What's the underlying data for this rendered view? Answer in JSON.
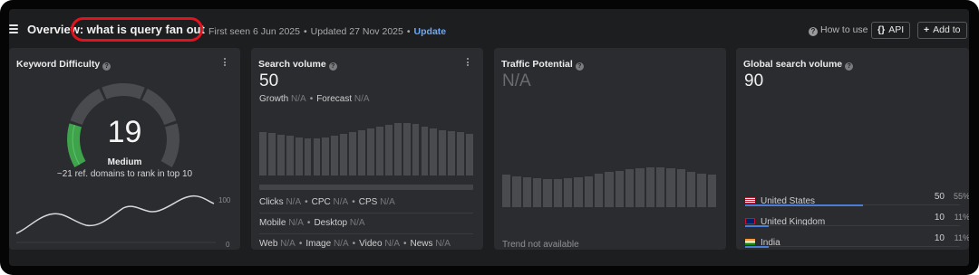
{
  "header": {
    "title_prefix": "Overview",
    "title_separator": ":",
    "keyword": "what is query fan out",
    "first_seen": "First seen 6 Jun 2025",
    "updated": "Updated 27 Nov 2025",
    "dot": "•",
    "update_link": "Update",
    "how_to_use": "How to use",
    "api_icon": "{}",
    "api_label": "API",
    "add_icon": "+",
    "add_label": "Add to",
    "highlight_color": "#e0141e"
  },
  "kd": {
    "title": "Keyword Difficulty",
    "value": "19",
    "value_level": 19,
    "label": "Medium",
    "subtitle": "~21 ref. domains to rank in top 10",
    "chart_max": "100",
    "chart_min": "0",
    "gauge_active_color": "#3ea34b",
    "gauge_inactive_color": "#4a4b4e"
  },
  "sv": {
    "title": "Search volume",
    "value": "50",
    "growth_label": "Growth",
    "growth_value": "N/A",
    "forecast_label": "Forecast",
    "forecast_value": "N/A",
    "clicks_label": "Clicks",
    "clicks_value": "N/A",
    "cpc_label": "CPC",
    "cpc_value": "N/A",
    "cps_label": "CPS",
    "cps_value": "N/A",
    "mobile_label": "Mobile",
    "mobile_value": "N/A",
    "desktop_label": "Desktop",
    "desktop_value": "N/A",
    "web_label": "Web",
    "web_value": "N/A",
    "image_label": "Image",
    "image_value": "N/A",
    "video_label": "Video",
    "video_value": "N/A",
    "news_label": "News",
    "news_value": "N/A",
    "bars": [
      48,
      47,
      45,
      44,
      42,
      41,
      41,
      42,
      44,
      46,
      48,
      50,
      52,
      54,
      56,
      58,
      58,
      57,
      54,
      52,
      50,
      49,
      48,
      46
    ]
  },
  "tp": {
    "title": "Traffic Potential",
    "value": "N/A",
    "footer": "Trend not available",
    "bars": [
      60,
      58,
      56,
      54,
      52,
      52,
      54,
      56,
      58,
      62,
      65,
      68,
      70,
      72,
      74,
      74,
      72,
      70,
      66,
      62,
      60
    ]
  },
  "gsv": {
    "title": "Global search volume",
    "value": "90",
    "countries": [
      {
        "name": "United States",
        "volume": "50",
        "share": "55%",
        "share_value": 55,
        "flag": "us-flag"
      },
      {
        "name": "United Kingdom",
        "volume": "10",
        "share": "11%",
        "share_value": 11,
        "flag": "uk-flag"
      },
      {
        "name": "India",
        "volume": "10",
        "share": "11%",
        "share_value": 11,
        "flag": "india-flag"
      }
    ],
    "bar_color": "#4a7ed6"
  }
}
